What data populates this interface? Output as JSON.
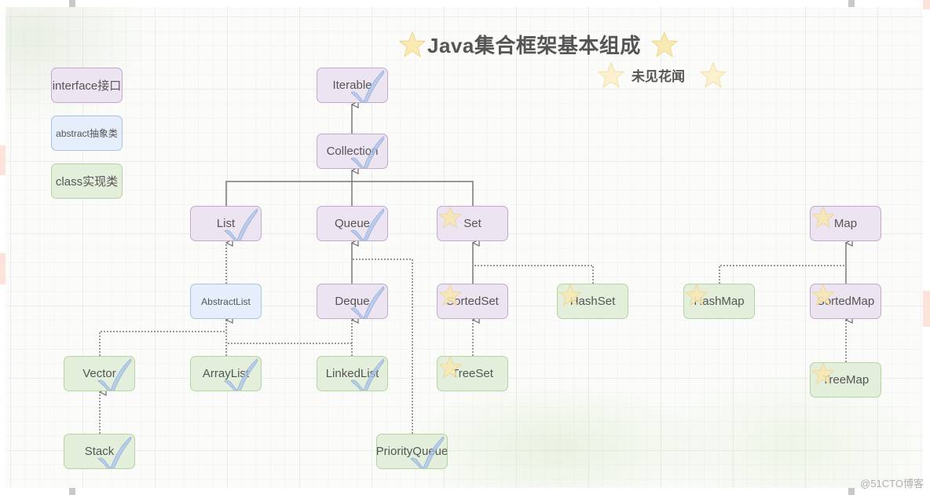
{
  "diagram": {
    "title": "Java集合框架基本组成",
    "subtitle": "未见花闻",
    "watermark": "@51CTO博客",
    "legend": [
      {
        "label": "interface接口",
        "kind": "interface"
      },
      {
        "label": "abstract抽象类",
        "kind": "abstract"
      },
      {
        "label": "class实现类",
        "kind": "class"
      }
    ],
    "colors": {
      "interface_fill": "#ede4f1",
      "interface_border": "#c3a9cd",
      "abstract_fill": "#e6eefb",
      "abstract_border": "#a9c1e3",
      "class_fill": "#e3eedb",
      "class_border": "#b5d3a3",
      "star": "#f7e7b0",
      "check": "#a9c3e8"
    },
    "nodes": {
      "iterable": {
        "label": "Iterable",
        "kind": "interface",
        "mark": "check"
      },
      "collection": {
        "label": "Collection",
        "kind": "interface",
        "mark": "check"
      },
      "list": {
        "label": "List",
        "kind": "interface",
        "mark": "check"
      },
      "queue": {
        "label": "Queue",
        "kind": "interface",
        "mark": "check"
      },
      "set": {
        "label": "Set",
        "kind": "interface",
        "mark": "star"
      },
      "map": {
        "label": "Map",
        "kind": "interface",
        "mark": "star"
      },
      "abstractlist": {
        "label": "AbstractList",
        "kind": "abstract",
        "mark": "none"
      },
      "deque": {
        "label": "Deque",
        "kind": "interface",
        "mark": "check"
      },
      "sortedset": {
        "label": "SortedSet",
        "kind": "interface",
        "mark": "star"
      },
      "hashset": {
        "label": "HashSet",
        "kind": "class",
        "mark": "star"
      },
      "hashmap": {
        "label": "HashMap",
        "kind": "class",
        "mark": "star"
      },
      "sortedmap": {
        "label": "SortedMap",
        "kind": "interface",
        "mark": "star"
      },
      "vector": {
        "label": "Vector",
        "kind": "class",
        "mark": "check"
      },
      "arraylist": {
        "label": "ArrayList",
        "kind": "class",
        "mark": "check"
      },
      "linkedlist": {
        "label": "LinkedList",
        "kind": "class",
        "mark": "check"
      },
      "treeset": {
        "label": "TreeSet",
        "kind": "class",
        "mark": "star"
      },
      "treemap": {
        "label": "TreeMap",
        "kind": "class",
        "mark": "star"
      },
      "stack": {
        "label": "Stack",
        "kind": "class",
        "mark": "check"
      },
      "priorityqueue": {
        "label": "PriorityQueue",
        "kind": "class",
        "mark": "check"
      }
    },
    "edges": [
      {
        "from": "collection",
        "to": "iterable",
        "style": "extends"
      },
      {
        "from": "list",
        "to": "collection",
        "style": "extends"
      },
      {
        "from": "queue",
        "to": "collection",
        "style": "extends"
      },
      {
        "from": "set",
        "to": "collection",
        "style": "extends"
      },
      {
        "from": "abstractlist",
        "to": "list",
        "style": "implements"
      },
      {
        "from": "deque",
        "to": "queue",
        "style": "extends"
      },
      {
        "from": "priorityqueue",
        "to": "queue",
        "style": "implements"
      },
      {
        "from": "sortedset",
        "to": "set",
        "style": "extends"
      },
      {
        "from": "hashset",
        "to": "set",
        "style": "implements"
      },
      {
        "from": "vector",
        "to": "abstractlist",
        "style": "implements"
      },
      {
        "from": "arraylist",
        "to": "abstractlist",
        "style": "implements"
      },
      {
        "from": "linkedlist",
        "to": "abstractlist",
        "style": "implements"
      },
      {
        "from": "linkedlist",
        "to": "deque",
        "style": "implements"
      },
      {
        "from": "stack",
        "to": "vector",
        "style": "implements"
      },
      {
        "from": "treeset",
        "to": "sortedset",
        "style": "implements"
      },
      {
        "from": "sortedmap",
        "to": "map",
        "style": "extends"
      },
      {
        "from": "hashmap",
        "to": "map",
        "style": "implements"
      },
      {
        "from": "treemap",
        "to": "sortedmap",
        "style": "implements"
      }
    ]
  }
}
